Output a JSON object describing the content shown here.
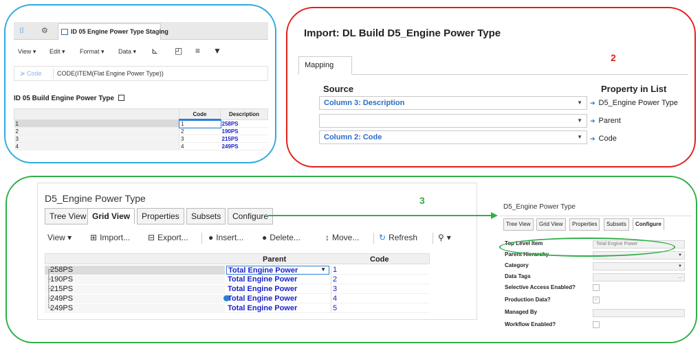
{
  "colors": {
    "panel1": "#2eaae0",
    "panel2": "#e0201a",
    "panel3": "#2fae48",
    "accent": "#2a7fd4",
    "value_text": "#1c22c8"
  },
  "panel1": {
    "callout": "1",
    "tab_label": "ID 05 Engine Power Type Staging",
    "tab_close": "×",
    "menus": [
      "View ▾",
      "Edit ▾",
      "Format ▾",
      "Data ▾"
    ],
    "formula_label": "≽ Code",
    "formula_value": "CODE(ITEM(Flat Engine Power Type))",
    "grid_title": "ID 05 Build Engine Power Type",
    "columns": [
      "Code",
      "Description"
    ],
    "rows": [
      {
        "num": "1",
        "code": "1",
        "desc": "258PS"
      },
      {
        "num": "2",
        "code": "2",
        "desc": "190PS"
      },
      {
        "num": "3",
        "code": "3",
        "desc": "215PS"
      },
      {
        "num": "4",
        "code": "4",
        "desc": "249PS"
      }
    ]
  },
  "panel2": {
    "callout": "2",
    "title": "Import: DL Build D5_Engine Power Type",
    "tab": "Mapping",
    "source_header": "Source",
    "property_header": "Property in List",
    "mappings": [
      {
        "source": "Column 3: Description",
        "property": "D5_Engine Power Type"
      },
      {
        "source": "",
        "property": "Parent"
      },
      {
        "source": "Column 2: Code",
        "property": "Code"
      }
    ]
  },
  "panel3": {
    "callout": "3",
    "title": "D5_Engine Power Type",
    "tabs": [
      "Tree View",
      "Grid View",
      "Properties",
      "Subsets",
      "Configure"
    ],
    "toolbar": [
      "View ▾",
      "Import...",
      "Export...",
      "Insert...",
      "Delete...",
      "Move...",
      "Refresh",
      "▾"
    ],
    "columns": [
      "Parent",
      "Code"
    ],
    "rows": [
      {
        "name": "258PS",
        "parent": "Total Engine Power",
        "code": "1"
      },
      {
        "name": "190PS",
        "parent": "Total Engine Power",
        "code": "2"
      },
      {
        "name": "215PS",
        "parent": "Total Engine Power",
        "code": "3"
      },
      {
        "name": "249PS",
        "parent": "Total Engine Power",
        "code": "4"
      },
      {
        "name": "249PS",
        "parent": "Total Engine Power",
        "code": "5"
      }
    ],
    "configure": {
      "title": "D5_Engine Power Type",
      "tabs": [
        "Tree View",
        "Grid View",
        "Properties",
        "Subsets",
        "Configure"
      ],
      "fields": [
        {
          "label": "Top Level Item",
          "value": "Total Engine Power",
          "kind": "text"
        },
        {
          "label": "Parent Hierarchy",
          "value": "",
          "kind": "select"
        },
        {
          "label": "Category",
          "value": "",
          "kind": "select"
        },
        {
          "label": "Data Tags",
          "value": "...",
          "kind": "text"
        },
        {
          "label": "Selective Access Enabled?",
          "value": "",
          "kind": "check"
        },
        {
          "label": "Production Data?",
          "value": "✓",
          "kind": "check"
        },
        {
          "label": "Managed By",
          "value": "",
          "kind": "text"
        },
        {
          "label": "Workflow Enabled?",
          "value": "",
          "kind": "check"
        }
      ]
    }
  }
}
